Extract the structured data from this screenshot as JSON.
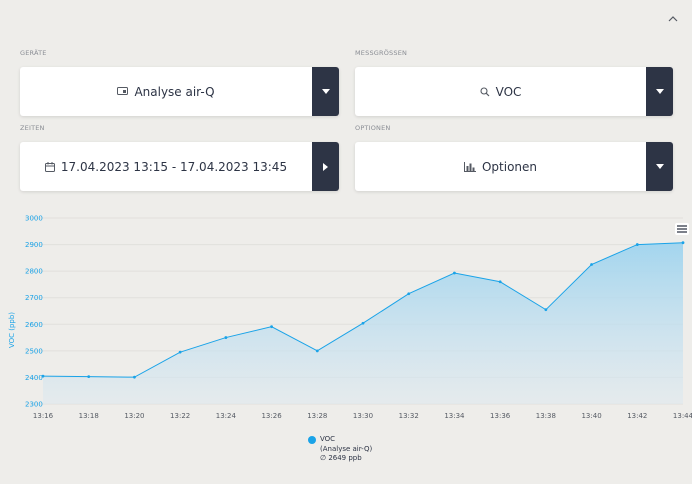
{
  "header": {
    "collapse_icon": "chevron-up-icon"
  },
  "devices": {
    "label": "GERÄTE",
    "value": "Analyse air-Q",
    "icon": "device-icon"
  },
  "metrics": {
    "label": "MESSGRÖSSEN",
    "value": "VOC",
    "icon": "search-icon"
  },
  "times": {
    "label": "ZEITEN",
    "value": "17.04.2023 13:15 - 17.04.2023 13:45",
    "icon": "calendar-icon"
  },
  "options": {
    "label": "OPTIONEN",
    "value": "Optionen",
    "icon": "bar-chart-icon"
  },
  "chart_menu": {
    "icon": "hamburger-menu-icon"
  },
  "legend": {
    "name": "VOC",
    "device": "(Analyse air-Q)",
    "average": "∅ 2649 ppb"
  },
  "colors": {
    "accent": "#1aa3e8",
    "dark": "#2d3445",
    "background": "#eeedea"
  },
  "chart_data": {
    "type": "area",
    "ylabel": "VOC (ppb)",
    "ylim": [
      2300,
      3000
    ],
    "yticks": [
      "3000",
      "2900",
      "2800",
      "2700",
      "2600",
      "2500",
      "2400",
      "2300"
    ],
    "xticks": [
      "13:16",
      "13:18",
      "13:20",
      "13:22",
      "13:24",
      "13:26",
      "13:28",
      "13:30",
      "13:32",
      "13:34",
      "13:36",
      "13:38",
      "13:40",
      "13:42",
      "13:44"
    ],
    "series": [
      {
        "name": "VOC",
        "x": [
          "13:16",
          "13:18",
          "13:20",
          "13:22",
          "13:24",
          "13:26",
          "13:28",
          "13:30",
          "13:32",
          "13:34",
          "13:36",
          "13:38",
          "13:40",
          "13:42",
          "13:44"
        ],
        "values": [
          2405,
          2403,
          2401,
          2495,
          2550,
          2591,
          2500,
          2604,
          2715,
          2793,
          2760,
          2655,
          2825,
          2900,
          2907
        ]
      }
    ],
    "grid": true,
    "legend_position": "bottom-center"
  }
}
